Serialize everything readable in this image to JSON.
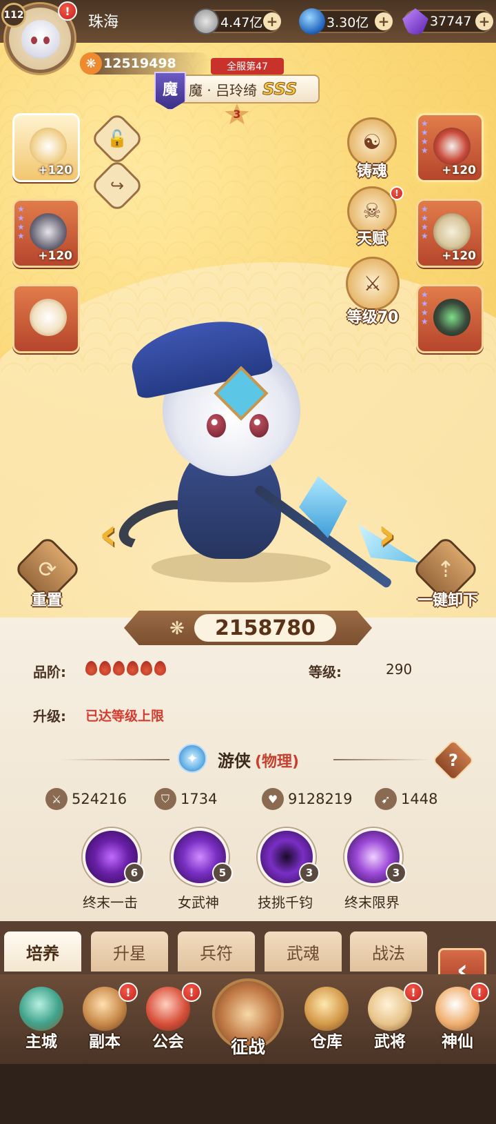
{
  "player": {
    "level": "112",
    "name": "珠海",
    "power": "12519498"
  },
  "resources": [
    {
      "icon": "coin-icon",
      "value": "4.47亿"
    },
    {
      "icon": "orb-icon",
      "value": "3.30亿"
    },
    {
      "icon": "crystal-icon",
      "value": "37747"
    }
  ],
  "hero": {
    "server_rank": "全服第47",
    "faction": "魔",
    "name": "魔 · 吕玲绮",
    "grade": "SSS",
    "stars": "3",
    "combat_power": "2158780"
  },
  "left_slots": [
    {
      "name": "equip-slot-1",
      "bonus": "+120",
      "style": "gold"
    },
    {
      "name": "equip-slot-2",
      "bonus": "+120",
      "style": "red"
    },
    {
      "name": "equip-slot-3",
      "bonus": "",
      "style": "red"
    }
  ],
  "right_slots": [
    {
      "name": "equip-slot-4",
      "bonus": "+120"
    },
    {
      "name": "equip-slot-5",
      "bonus": "+120"
    },
    {
      "name": "equip-slot-6",
      "bonus": ""
    }
  ],
  "functions": [
    {
      "label": "铸魂",
      "icon": "forge-soul-icon",
      "alert": false
    },
    {
      "label": "天赋",
      "icon": "talent-icon",
      "alert": true
    },
    {
      "label": "等级70",
      "icon": "weapon-level-icon",
      "alert": false
    }
  ],
  "actions": {
    "reset": "重置",
    "unequip_all": "一键卸下"
  },
  "attributes": {
    "rank_label": "品阶:",
    "rank_drops": 6,
    "level_label": "等级:",
    "level_value": "290",
    "upgrade_label": "升级:",
    "upgrade_status": "已达等级上限"
  },
  "hero_class": {
    "name": "游侠",
    "type": "(物理)"
  },
  "stats": [
    {
      "icon": "sword-icon",
      "value": "524216"
    },
    {
      "icon": "shield-icon",
      "value": "1734"
    },
    {
      "icon": "heart-icon",
      "value": "9128219"
    },
    {
      "icon": "boot-icon",
      "value": "1448"
    }
  ],
  "skills": [
    {
      "name": "终末一击",
      "level": "6",
      "icon": "final-strike-icon"
    },
    {
      "name": "女武神",
      "level": "5",
      "icon": "valkyrie-icon"
    },
    {
      "name": "技挑千钧",
      "level": "3",
      "icon": "vortex-icon"
    },
    {
      "name": "终末限界",
      "level": "3",
      "icon": "paw-skill-icon"
    }
  ],
  "tabs": [
    "培养",
    "升星",
    "兵符",
    "武魂",
    "战法"
  ],
  "active_tab": 0,
  "nav": [
    {
      "label": "主城",
      "icon": "city-icon",
      "alert": false
    },
    {
      "label": "副本",
      "icon": "dungeon-icon",
      "alert": true
    },
    {
      "label": "公会",
      "icon": "guild-icon",
      "alert": true
    },
    {
      "label": "征战",
      "icon": "battle-icon",
      "alert": false
    },
    {
      "label": "仓库",
      "icon": "warehouse-icon",
      "alert": false
    },
    {
      "label": "武将",
      "icon": "generals-icon",
      "alert": true
    },
    {
      "label": "神仙",
      "icon": "immortals-icon",
      "alert": true
    }
  ],
  "colors": {
    "accent_red": "#d23c2f",
    "panel": "#f6efe2",
    "stage": "#fbd877",
    "nav_bg": "#5a4031"
  }
}
